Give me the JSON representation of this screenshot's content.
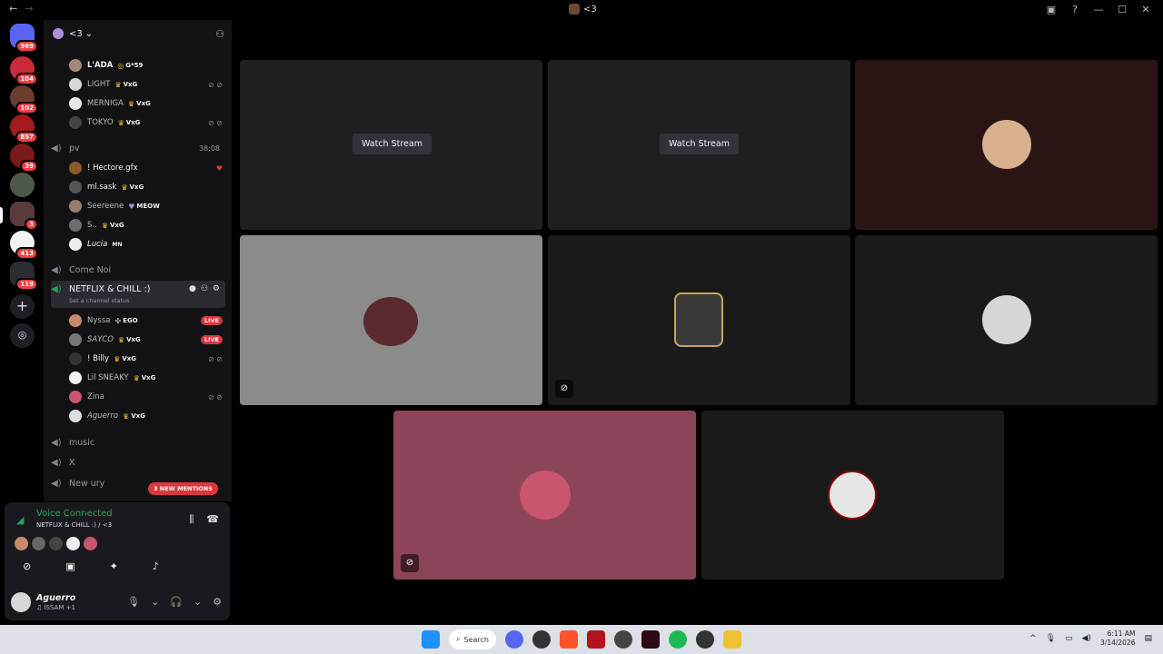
{
  "titlebar": {
    "title": "<3",
    "nav_back": "←",
    "nav_forward": "→"
  },
  "rail": {
    "badges": [
      "969",
      "104",
      "102",
      "857",
      "39",
      "3",
      "413",
      "119"
    ]
  },
  "guild": {
    "name": "<3",
    "chevron": "⌄"
  },
  "channel_users_top": [
    {
      "name": "L'ADA",
      "tag": "G*59"
    },
    {
      "name": "LIGHT",
      "tag": "VxG"
    },
    {
      "name": "MERNIGA",
      "tag": "VxG"
    },
    {
      "name": "TOKYO",
      "tag": "VxG"
    }
  ],
  "pv": {
    "name": "pv",
    "time": "38:08",
    "users": [
      {
        "name": "! Hectore.gfx",
        "tag": ""
      },
      {
        "name": "ml.sask",
        "tag": "VxG"
      },
      {
        "name": "Seereene",
        "tag": "MEOW"
      },
      {
        "name": "S..",
        "tag": "VxG"
      },
      {
        "name": "Lucia",
        "tag": "MN"
      }
    ]
  },
  "channels": {
    "come_noi": "Come Noi",
    "netflix": "NETFLIX & CHILL :)",
    "netflix_status": "Set a channel status",
    "music": "music",
    "x": "X",
    "new": "New ury"
  },
  "netflix_users": [
    {
      "name": "Nyssa",
      "tag": "EGO",
      "live": "LIVE"
    },
    {
      "name": "SAYCO",
      "tag": "VxG",
      "live": "LIVE"
    },
    {
      "name": "! Billy",
      "tag": "VxG",
      "live": ""
    },
    {
      "name": "Lil SNEAKY",
      "tag": "VxG",
      "live": ""
    },
    {
      "name": "Zina",
      "tag": "",
      "live": ""
    },
    {
      "name": "Aguerro",
      "tag": "VxG",
      "live": ""
    }
  ],
  "mentions": "3 NEW MENTIONS",
  "voice": {
    "status": "Voice Connected",
    "location": "NETFLIX & CHILL :) / <3"
  },
  "me": {
    "name": "Aguerro",
    "status": "♫ ISSAM +1"
  },
  "stage": {
    "watch_label_1": "Watch Stream",
    "watch_label_2": "Watch Stream"
  },
  "taskbar": {
    "search": "Search",
    "time": "6:11 AM",
    "date": "3/14/2026"
  }
}
